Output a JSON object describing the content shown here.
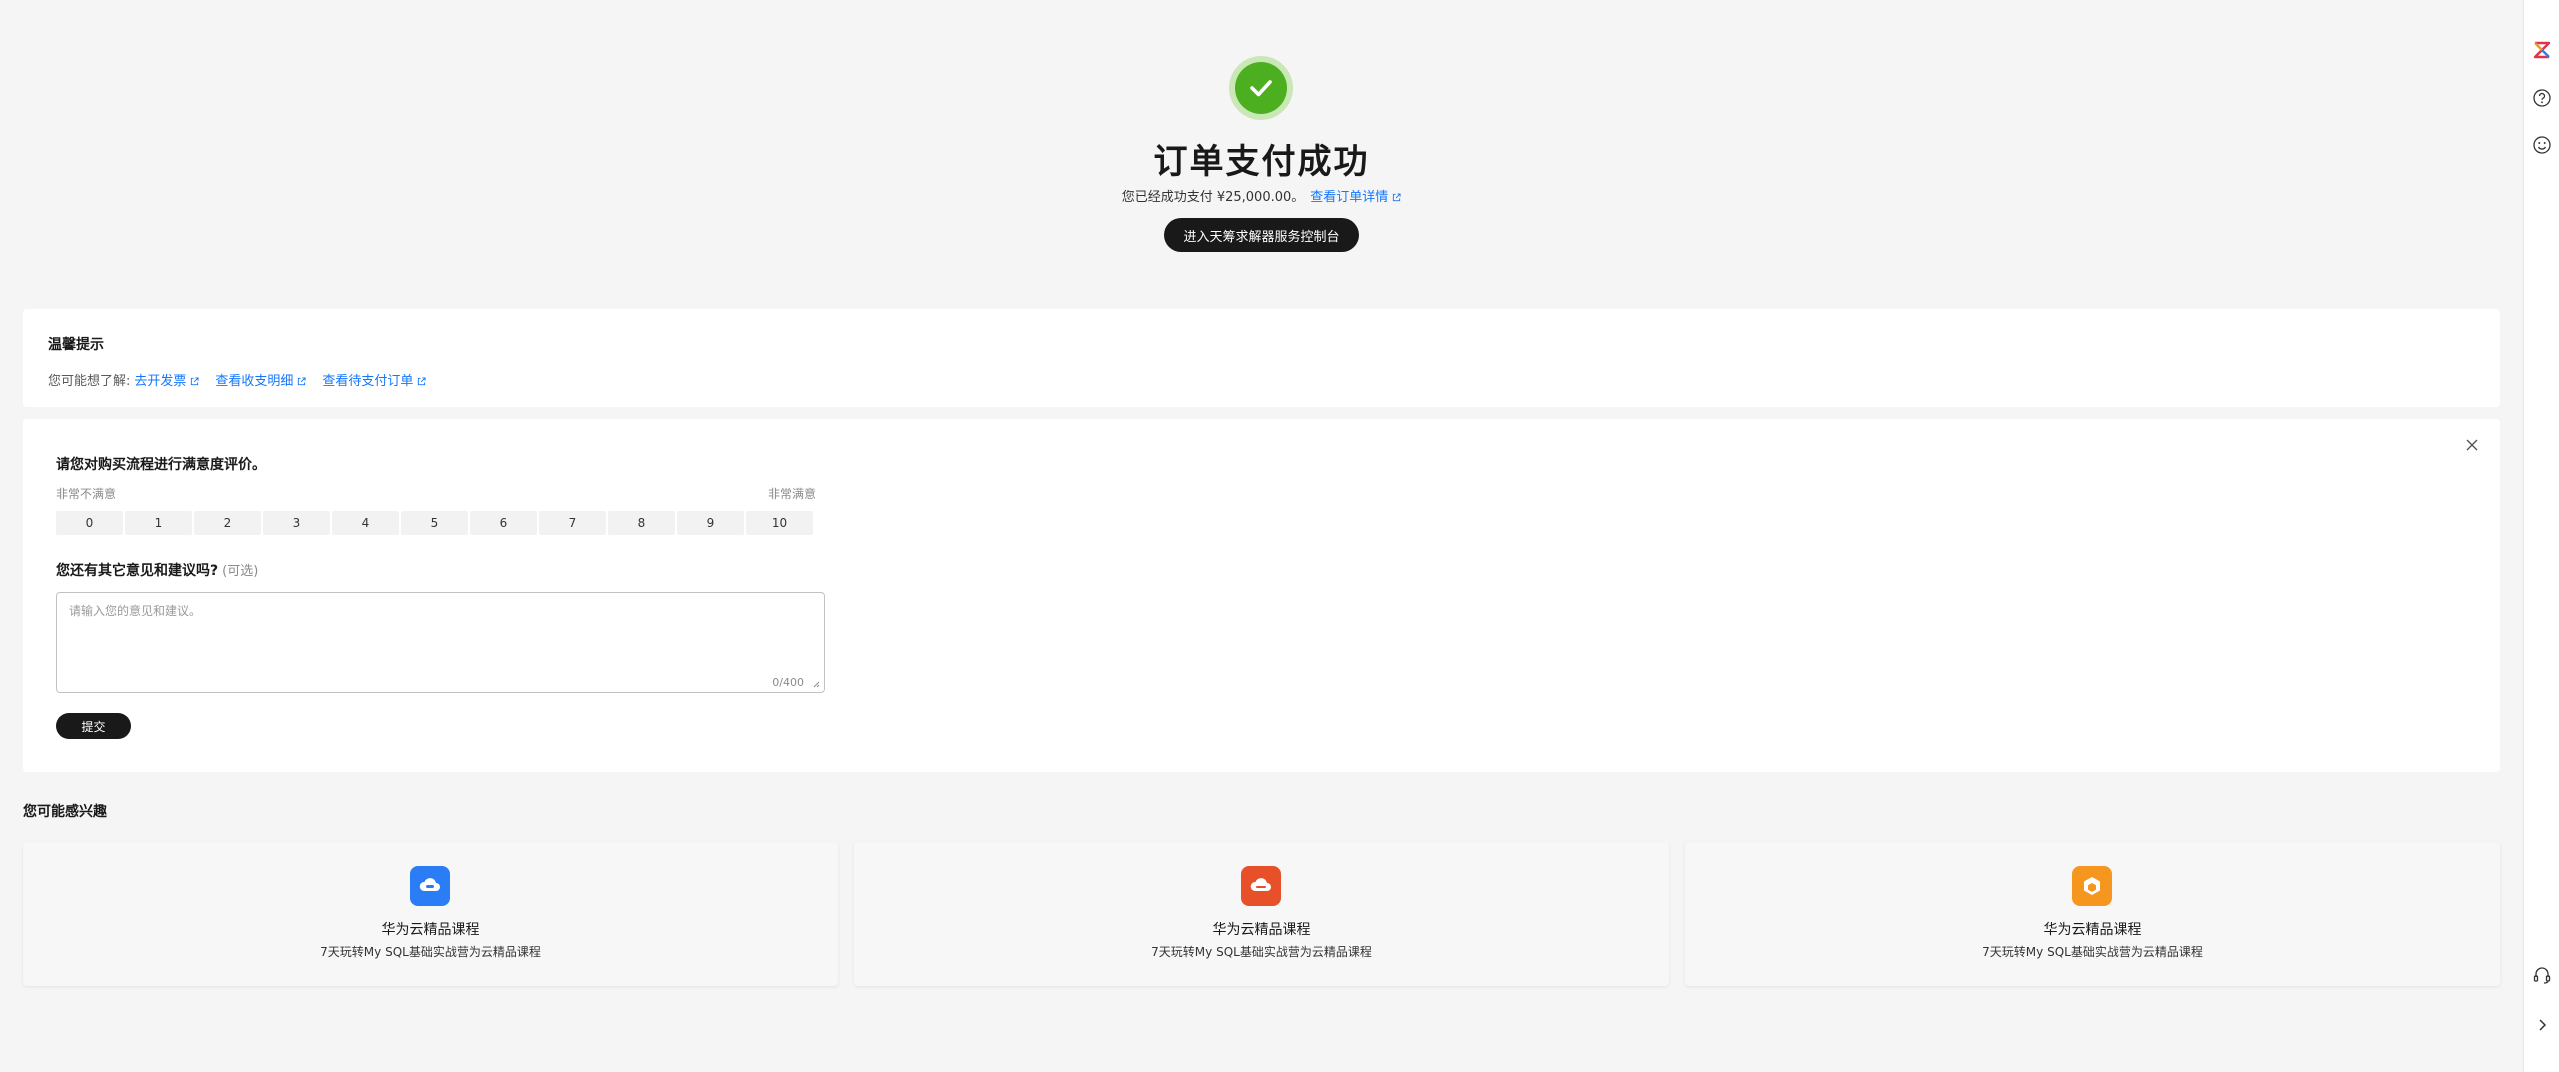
{
  "hero": {
    "title": "订单支付成功",
    "paid_prefix": "您已经成功支付 ¥25,000.00。",
    "order_link": "查看订单详情",
    "console_button": "进入天筹求解器服务控制台"
  },
  "tips": {
    "title": "温馨提示",
    "lead": "您可能想了解:",
    "links": [
      "去开发票",
      "查看收支明细",
      "查看待支付订单"
    ]
  },
  "survey": {
    "question": "请您对购买流程进行满意度评价。",
    "low_label": "非常不满意",
    "high_label": "非常满意",
    "scale": [
      "0",
      "1",
      "2",
      "3",
      "4",
      "5",
      "6",
      "7",
      "8",
      "9",
      "10"
    ],
    "suggest_question": "您还有其它意见和建议吗?",
    "optional": "(可选)",
    "placeholder": "请输入您的意见和建议。",
    "counter": "0/400",
    "submit": "提交"
  },
  "recommend": {
    "title": "您可能感兴趣",
    "items": [
      {
        "title": "华为云精品课程",
        "subtitle": "7天玩转My SQL基础实战营为云精品课程",
        "color": "#2a7df4",
        "icon": "cloud-database-icon"
      },
      {
        "title": "华为云精品课程",
        "subtitle": "7天玩转My SQL基础实战营为云精品课程",
        "color": "#e8502a",
        "icon": "cloud-server-icon"
      },
      {
        "title": "华为云精品课程",
        "subtitle": "7天玩转My SQL基础实战营为云精品课程",
        "color": "#f5961e",
        "icon": "package-icon"
      }
    ]
  },
  "colors": {
    "accent": "#1476ff",
    "success": "#4caf1f",
    "dark_button": "#191919"
  },
  "rail_icons": [
    "brand-logo-icon",
    "help-icon",
    "smiley-feedback-icon",
    "headset-support-icon",
    "chevron-right-icon"
  ]
}
